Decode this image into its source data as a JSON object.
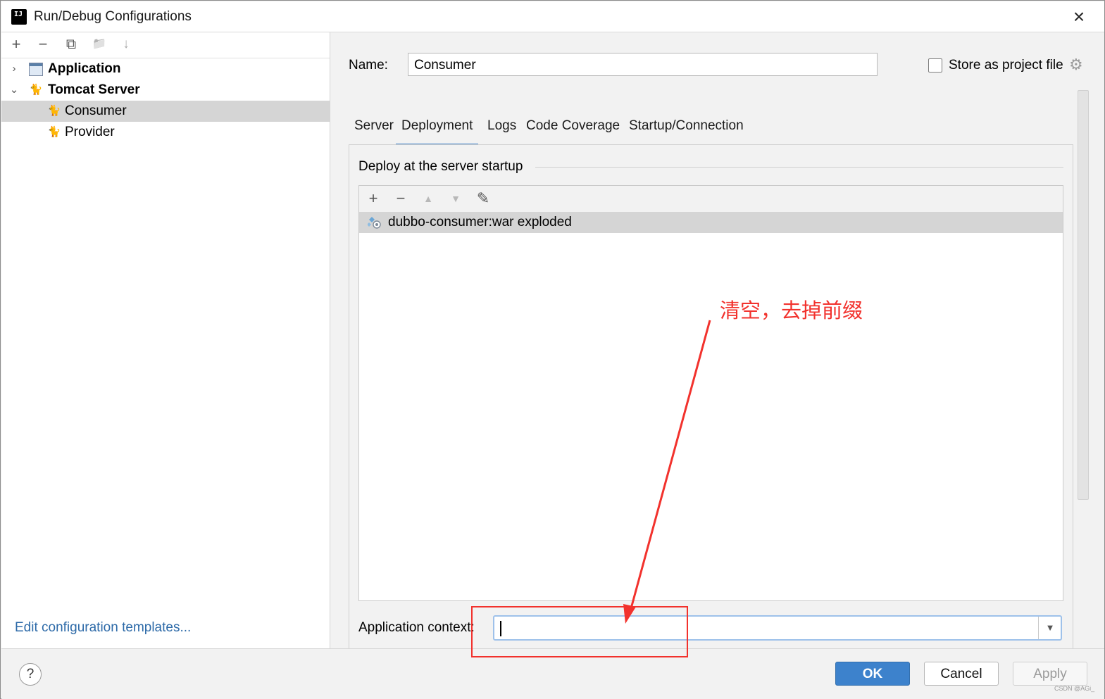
{
  "window": {
    "title": "Run/Debug Configurations",
    "close_glyph": "×"
  },
  "left_toolbar": {
    "add": "+",
    "remove": "−",
    "copy": "⧉",
    "folder": "📁",
    "sort": "↓"
  },
  "tree": [
    {
      "label": "Application",
      "expanded": false,
      "bold": true
    },
    {
      "label": "Tomcat Server",
      "expanded": true,
      "bold": true
    },
    {
      "label": "Consumer",
      "selected": true
    },
    {
      "label": "Provider",
      "selected": false
    }
  ],
  "tree_arrows": {
    "collapsed": "›",
    "expanded": "⌄"
  },
  "edit_templates_link": "Edit configuration templates...",
  "name_label": "Name:",
  "name_value": "Consumer",
  "store_as_project_file": "Store as project file",
  "tabs": [
    {
      "label": "Server",
      "active": false
    },
    {
      "label": "Deployment",
      "active": true
    },
    {
      "label": "Logs",
      "active": false
    },
    {
      "label": "Code Coverage",
      "active": false
    },
    {
      "label": "Startup/Connection",
      "active": false
    }
  ],
  "deployment": {
    "section_title": "Deploy at the server startup",
    "toolbar": {
      "add": "+",
      "remove": "−",
      "up": "▲",
      "down": "▼",
      "edit": "✎"
    },
    "artifacts": [
      "dubbo-consumer:war exploded"
    ],
    "app_context_label": "Application context:",
    "app_context_value": ""
  },
  "buttons": {
    "help": "?",
    "ok": "OK",
    "cancel": "Cancel",
    "apply": "Apply"
  },
  "annotation": {
    "text": "清空，去掉前缀",
    "color": "#f2322d"
  },
  "watermark": "CSDN @AGi_",
  "colors": {
    "accent": "#4083c9",
    "ok_button": "#3d82cc",
    "selection": "#d5d5d5",
    "link": "#2d6aa8"
  }
}
